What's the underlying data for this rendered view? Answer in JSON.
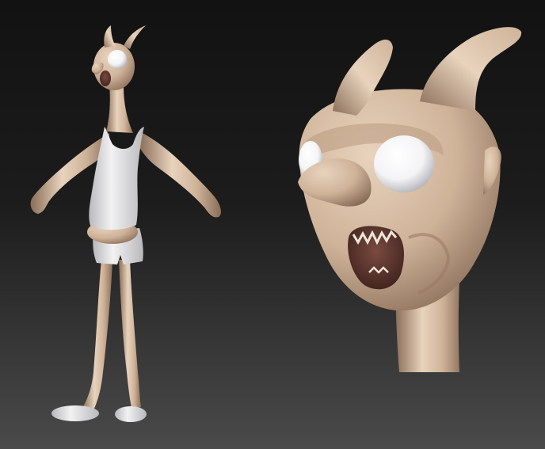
{
  "scene": {
    "background_top": "#121212",
    "background_bottom": "#4a4a4a",
    "clay_color": "#cfb399",
    "clay_highlight": "#e8d3bd",
    "clay_shadow": "#8a6d58",
    "cloth_color": "#f2f2f2",
    "cloth_shadow": "#b9b9bd",
    "eye_color": "#f4f4f6",
    "mouth_color": "#3a1f1b"
  }
}
